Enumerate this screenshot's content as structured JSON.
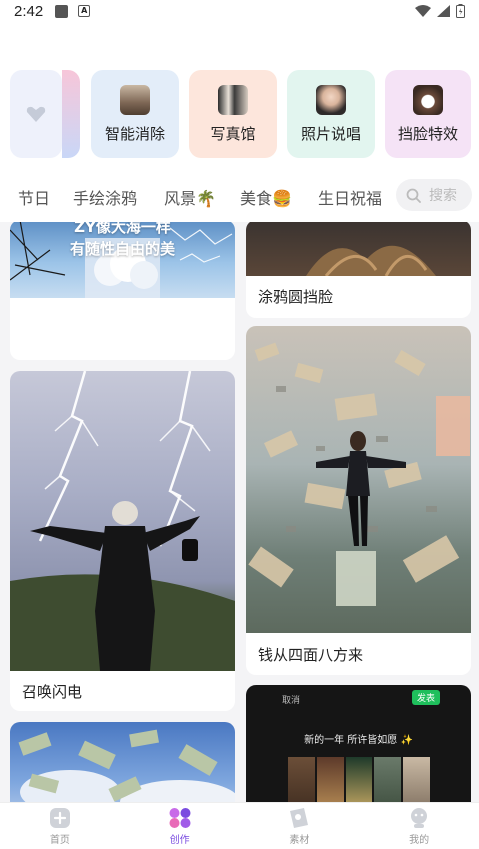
{
  "status_bar": {
    "time": "2:42"
  },
  "tools": [
    {
      "label": "",
      "bg": "#eef1fb"
    },
    {
      "label": "智能消除",
      "bg": "#e3edf9"
    },
    {
      "label": "写真馆",
      "bg": "#fde6dc"
    },
    {
      "label": "照片说唱",
      "bg": "#e2f5ef"
    },
    {
      "label": "挡脸特效",
      "bg": "#f5e3f6"
    }
  ],
  "categories": [
    "节日",
    "手绘涂鸦",
    "风景🌴",
    "美食🍔",
    "生日祝福"
  ],
  "search": {
    "placeholder": "搜索"
  },
  "feed": {
    "card_sea_text": "ZY像大海一样\n有随性自由的美",
    "card_graffiti_title": "涂鸦圆挡脸",
    "card_lightning_title": "召唤闪电",
    "card_money_title": "钱从四面八方来",
    "card_dark_header_cancel": "取消",
    "card_dark_header_publish": "发表",
    "card_dark_caption": "新的一年 所许皆如愿 ✨"
  },
  "tabbar": {
    "items": [
      {
        "label": "首页",
        "active": false
      },
      {
        "label": "创作",
        "active": true
      },
      {
        "label": "素材",
        "active": false
      },
      {
        "label": "我的",
        "active": false
      }
    ]
  },
  "colors": {
    "accent": "#7a4ce0"
  }
}
